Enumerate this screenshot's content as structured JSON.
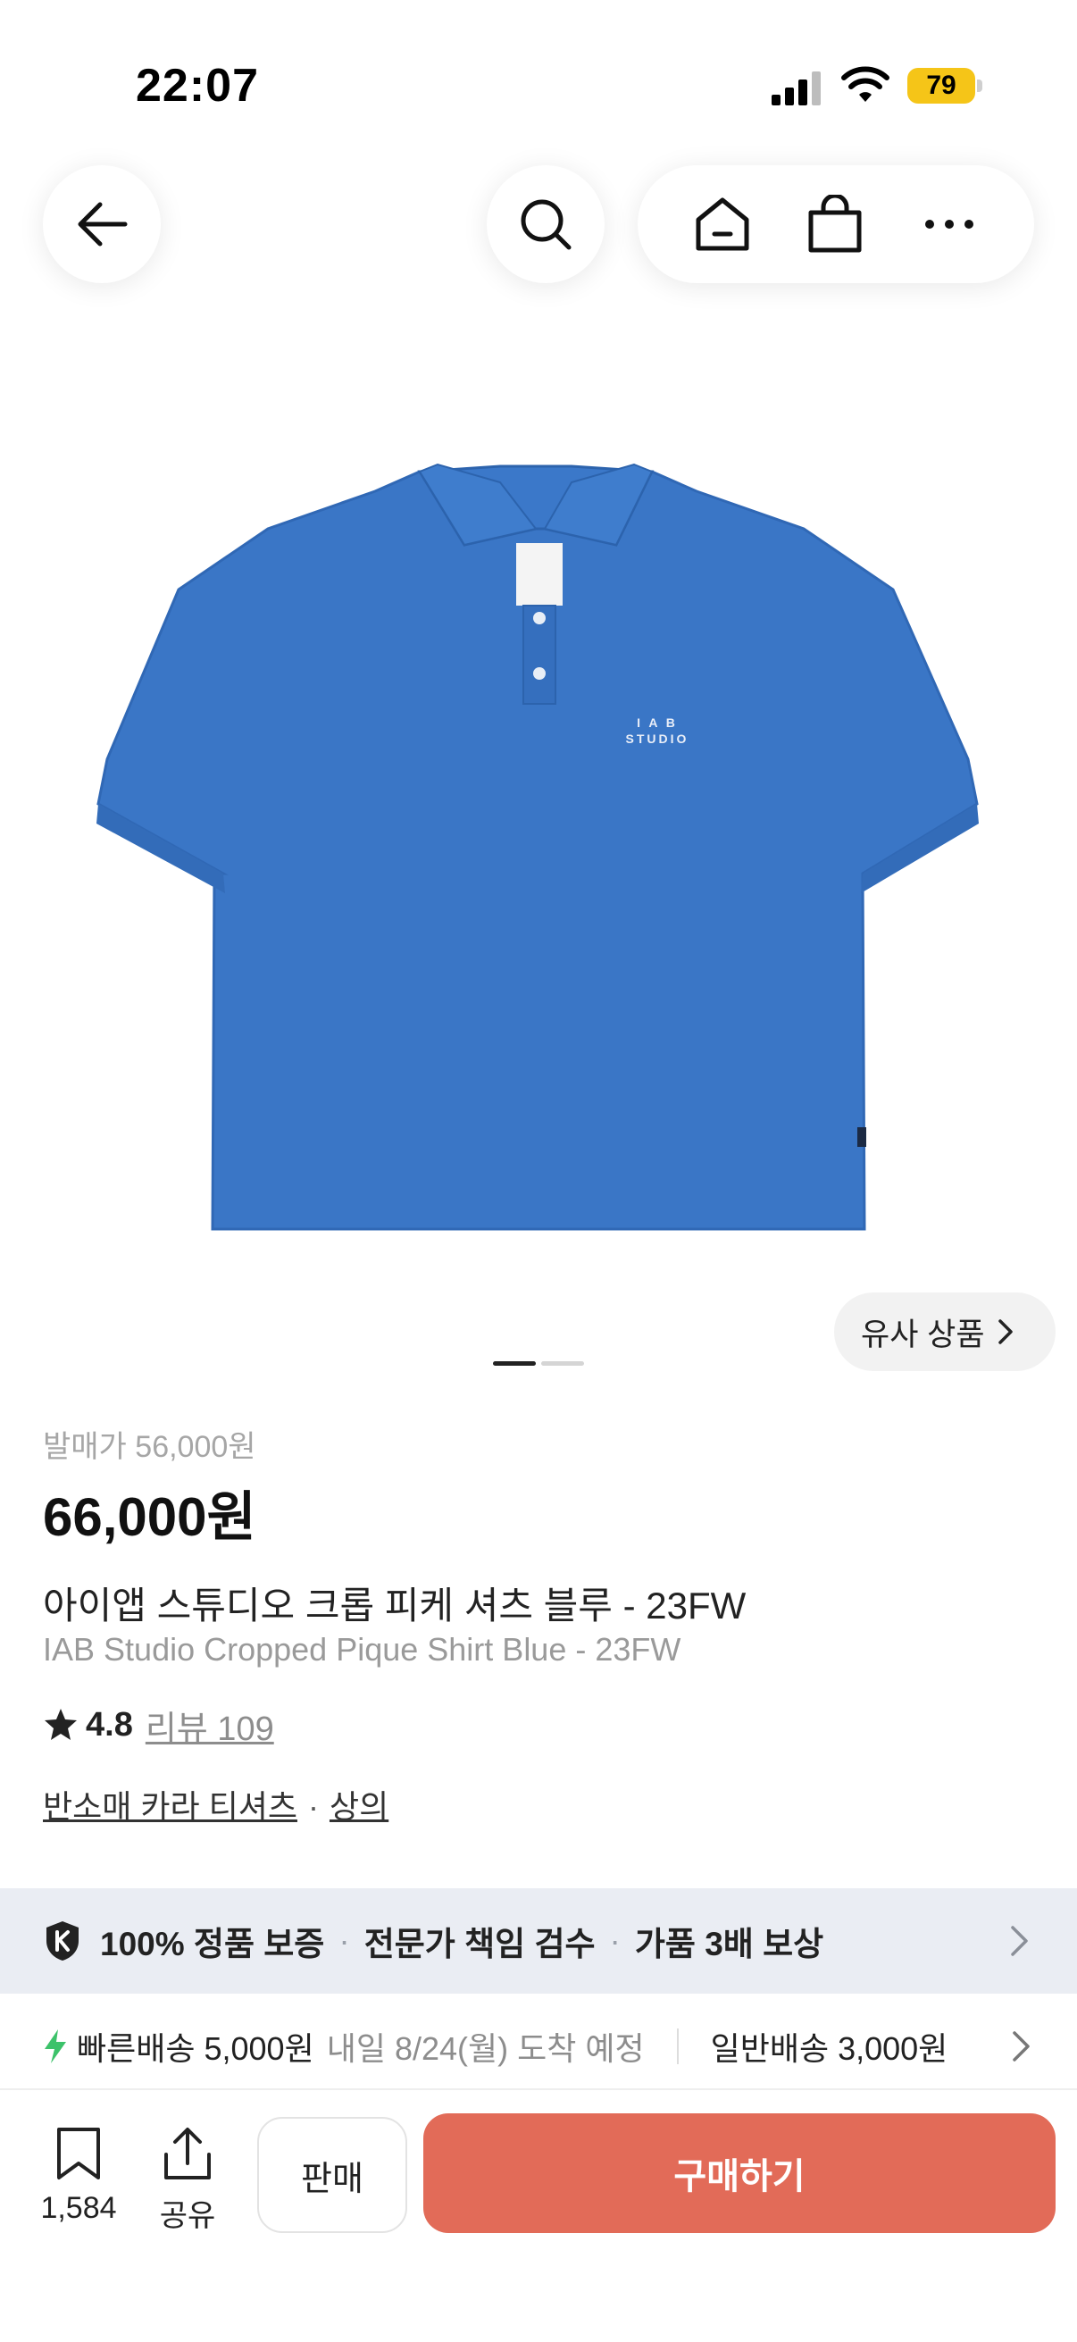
{
  "status_bar": {
    "time": "22:07",
    "battery_level": "79"
  },
  "header": {
    "back": "back-arrow-icon",
    "search": "search-icon",
    "home": "home-icon",
    "bag": "shopping-bag-icon",
    "more": "more-dots-icon"
  },
  "gallery": {
    "similar_button": "유사 상품",
    "image_count": 2,
    "current_index": 1,
    "shirt_logo_top": "I A B",
    "shirt_logo_bottom": "STUDIO",
    "shirt_color": "#3a76c6"
  },
  "product": {
    "release_price": "발매가 56,000원",
    "price": "66,000원",
    "name_ko": "아이앱 스튜디오 크롭 피케 셔츠 블루 - 23FW",
    "name_en": "IAB Studio Cropped Pique Shirt Blue - 23FW",
    "rating": "4.8",
    "review_label": "리뷰 109",
    "category_primary": "반소매 카라 티셔츠",
    "category_sep": "·",
    "category_secondary": "상의"
  },
  "guarantee": {
    "item1": "100% 정품 보증",
    "item2": "전문가 책임 검수",
    "item3": "가품 3배 보상",
    "sep": "·"
  },
  "delivery": {
    "fast_label": "빠른배송 5,000원",
    "fast_date": "내일 8/24(월) 도착 예정",
    "normal_label": "일반배송 3,000원"
  },
  "bottom_bar": {
    "saved_count": "1,584",
    "share_label": "공유",
    "sell_label": "판매",
    "buy_label": "구매하기"
  },
  "colors": {
    "buy_button": "#e26b58",
    "battery": "#f5c518",
    "guarantee_bg": "#eaedf3",
    "bolt": "#3cc26a"
  }
}
